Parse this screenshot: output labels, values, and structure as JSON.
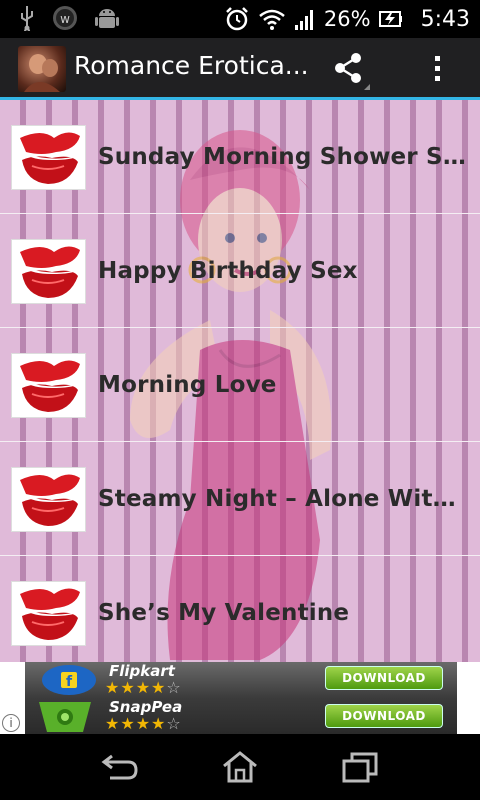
{
  "status_bar": {
    "icons": [
      "usb-icon",
      "w-app-icon",
      "android-debug-icon",
      "alarm-icon",
      "wifi-icon",
      "signal-icon",
      "battery-charging-icon"
    ],
    "battery": "26%",
    "time": "5:43"
  },
  "action_bar": {
    "title": "Romance Erotica...",
    "share_icon": "share-icon",
    "overflow_icon": "overflow-menu-icon"
  },
  "list": {
    "items": [
      {
        "title": "Sunday Morning Shower Sex",
        "icon": "lips-icon"
      },
      {
        "title": "Happy Birthday Sex",
        "icon": "lips-icon"
      },
      {
        "title": "Morning Love",
        "icon": "lips-icon"
      },
      {
        "title": "Steamy Night – Alone With You",
        "icon": "lips-icon"
      },
      {
        "title": "She’s My Valentine",
        "icon": "lips-icon"
      }
    ]
  },
  "ad": {
    "apps": [
      {
        "name": "Flipkart",
        "stars": 4,
        "button": "DOWNLOAD"
      },
      {
        "name": "SnapPea",
        "stars": 4,
        "button": "DOWNLOAD"
      }
    ],
    "info": "i"
  },
  "nav_bar": {
    "buttons": [
      "back-icon",
      "home-icon",
      "recent-apps-icon"
    ]
  },
  "colors": {
    "accent": "#33b5e5",
    "stripe_light": "#e0bad9",
    "stripe_dark": "#b986b0"
  }
}
